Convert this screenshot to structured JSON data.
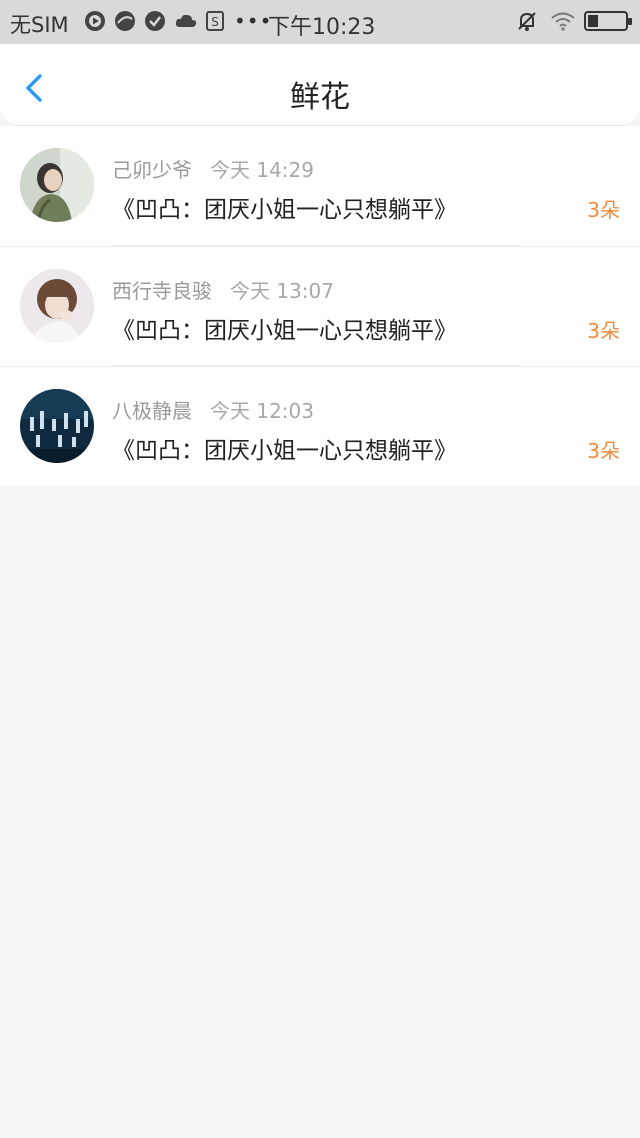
{
  "status_bar": {
    "carrier": "无SIM",
    "time": "下午10:23"
  },
  "nav": {
    "title": "鲜花"
  },
  "items": [
    {
      "name": "己卯少爷",
      "time": "今天 14:29",
      "title": "《凹凸：团厌小姐一心只想躺平》",
      "count": "3朵"
    },
    {
      "name": "西行寺良骏",
      "time": "今天 13:07",
      "title": "《凹凸：团厌小姐一心只想躺平》",
      "count": "3朵"
    },
    {
      "name": "八极静晨",
      "time": "今天 12:03",
      "title": "《凹凸：团厌小姐一心只想躺平》",
      "count": "3朵"
    }
  ],
  "colors": {
    "accent": "#2b9af3",
    "count": "#f08a3c"
  }
}
